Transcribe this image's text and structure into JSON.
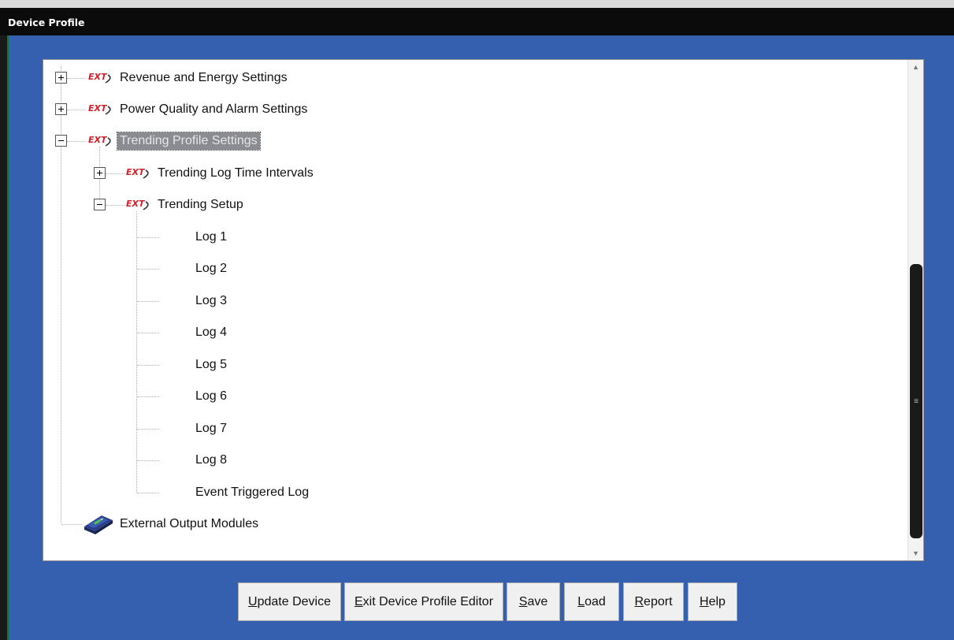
{
  "window": {
    "title": "Device Profile"
  },
  "tree": {
    "items": [
      {
        "label": "Revenue and Energy Settings",
        "expander": "plus",
        "icon": "ext-icon"
      },
      {
        "label": "Power Quality and Alarm Settings",
        "expander": "plus",
        "icon": "ext-icon"
      },
      {
        "label": "Trending Profile Settings",
        "expander": "minus",
        "icon": "ext-icon",
        "selected": true
      },
      {
        "label": "Trending Log Time Intervals",
        "expander": "plus",
        "icon": "ext-icon"
      },
      {
        "label": "Trending Setup",
        "expander": "minus",
        "icon": "ext-icon"
      },
      {
        "label": "Log 1"
      },
      {
        "label": "Log 2"
      },
      {
        "label": "Log 3"
      },
      {
        "label": "Log 4"
      },
      {
        "label": "Log 5"
      },
      {
        "label": "Log 6"
      },
      {
        "label": "Log 7"
      },
      {
        "label": "Log 8"
      },
      {
        "label": "Event Triggered Log"
      },
      {
        "label": "External Output Modules",
        "icon": "output-module-icon"
      }
    ],
    "ext_icon_text": "EXT"
  },
  "buttons": {
    "update": {
      "first": "U",
      "rest": "pdate Device"
    },
    "exit": {
      "first": "E",
      "rest": "xit Device Profile Editor"
    },
    "save": {
      "first": "S",
      "rest": "ave"
    },
    "load": {
      "first": "L",
      "rest": "oad"
    },
    "report": {
      "first": "R",
      "rest": "eport"
    },
    "help": {
      "first": "H",
      "rest": "elp"
    }
  },
  "colors": {
    "frame": "#3560b0",
    "titlebar": "#0b0b0b",
    "selection": "#8a8c92",
    "ext_icon": "#d2232a"
  }
}
